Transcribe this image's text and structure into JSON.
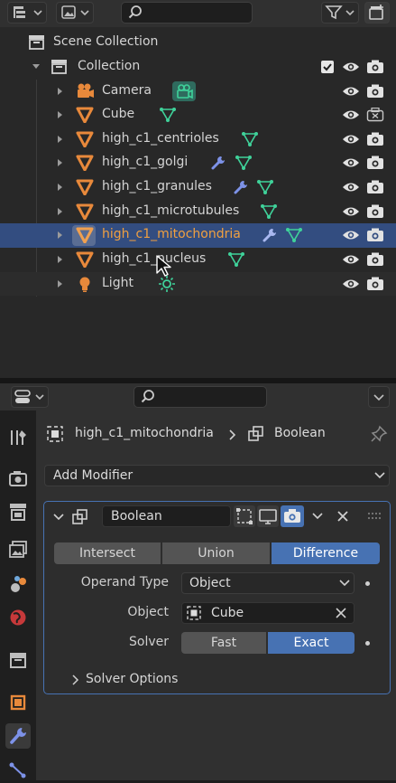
{
  "outliner": {
    "scene_collection": "Scene Collection",
    "collection": "Collection",
    "rows": [
      {
        "label": "Camera",
        "type": "camera"
      },
      {
        "label": "Cube",
        "type": "mesh"
      },
      {
        "label": "high_c1_centrioles",
        "type": "mesh"
      },
      {
        "label": "high_c1_golgi",
        "type": "mesh"
      },
      {
        "label": "high_c1_granules",
        "type": "mesh"
      },
      {
        "label": "high_c1_microtubules",
        "type": "mesh"
      },
      {
        "label": "high_c1_mitochondria",
        "type": "mesh",
        "selected": true
      },
      {
        "label": "high_c1_nucleus",
        "type": "mesh"
      },
      {
        "label": "Light",
        "type": "light"
      }
    ]
  },
  "properties": {
    "breadcrumb_object": "high_c1_mitochondria",
    "breadcrumb_modifier": "Boolean",
    "add_modifier": "Add Modifier",
    "modifier": {
      "name": "Boolean",
      "operations": [
        "Intersect",
        "Union",
        "Difference"
      ],
      "operation_selected": "Difference",
      "operand_type_label": "Operand Type",
      "operand_type_value": "Object",
      "object_label": "Object",
      "object_value": "Cube",
      "solver_label": "Solver",
      "solver_options": [
        "Fast",
        "Exact"
      ],
      "solver_selected": "Exact",
      "solver_options_panel": "Solver Options"
    }
  },
  "colors": {
    "mesh": "#e8893b",
    "data_green": "#3fd29a",
    "wrench_blue": "#7d92e8",
    "accent": "#4772b3",
    "selected_row": "#334d80"
  }
}
